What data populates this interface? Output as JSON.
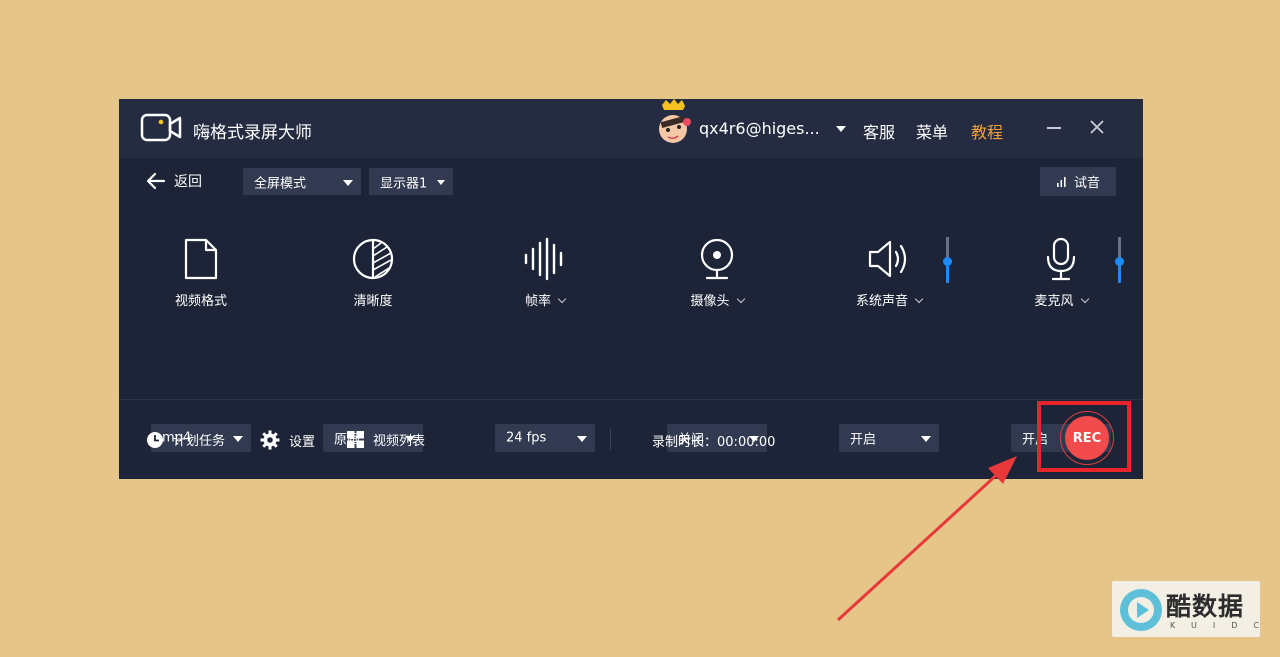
{
  "app": {
    "title": "嗨格式录屏大师",
    "user": "qx4r6@higes...",
    "nav": {
      "service": "客服",
      "menu": "菜单",
      "tutorial": "教程"
    }
  },
  "toolbar": {
    "back_label": "返回",
    "mode": "全屏模式",
    "display": "显示器1",
    "test_audio": "试音"
  },
  "settings": [
    {
      "label": "视频格式",
      "value": "mp4",
      "icon": "file-icon",
      "has_chevron": false
    },
    {
      "label": "清晰度",
      "value": "原画",
      "icon": "half-circle-icon",
      "has_chevron": false
    },
    {
      "label": "帧率",
      "value": "24 fps",
      "icon": "waveform-icon",
      "has_chevron": true
    },
    {
      "label": "摄像头",
      "value": "关闭",
      "icon": "webcam-icon",
      "has_chevron": true
    },
    {
      "label": "系统声音",
      "value": "开启",
      "icon": "speaker-icon",
      "has_chevron": true
    },
    {
      "label": "麦克风",
      "value": "开启",
      "icon": "microphone-icon",
      "has_chevron": true
    }
  ],
  "volume": {
    "system_level": 0.45,
    "mic_level": 0.45
  },
  "bottom": {
    "schedule": "计划任务",
    "settings": "设置",
    "video_list": "视频列表",
    "duration_label": "录制时长：",
    "duration_value": "00:00:00"
  },
  "rec": {
    "label": "REC"
  },
  "watermark": {
    "main": "酷数据",
    "sub": "KUIDC"
  },
  "colors": {
    "background": "#e5c688",
    "window": "#1e2437",
    "titlebar": "#252c42",
    "accent_orange": "#f5a03b",
    "accent_blue": "#1d8af5",
    "rec_red": "#f14b4b",
    "highlight_red": "#e8252c"
  }
}
